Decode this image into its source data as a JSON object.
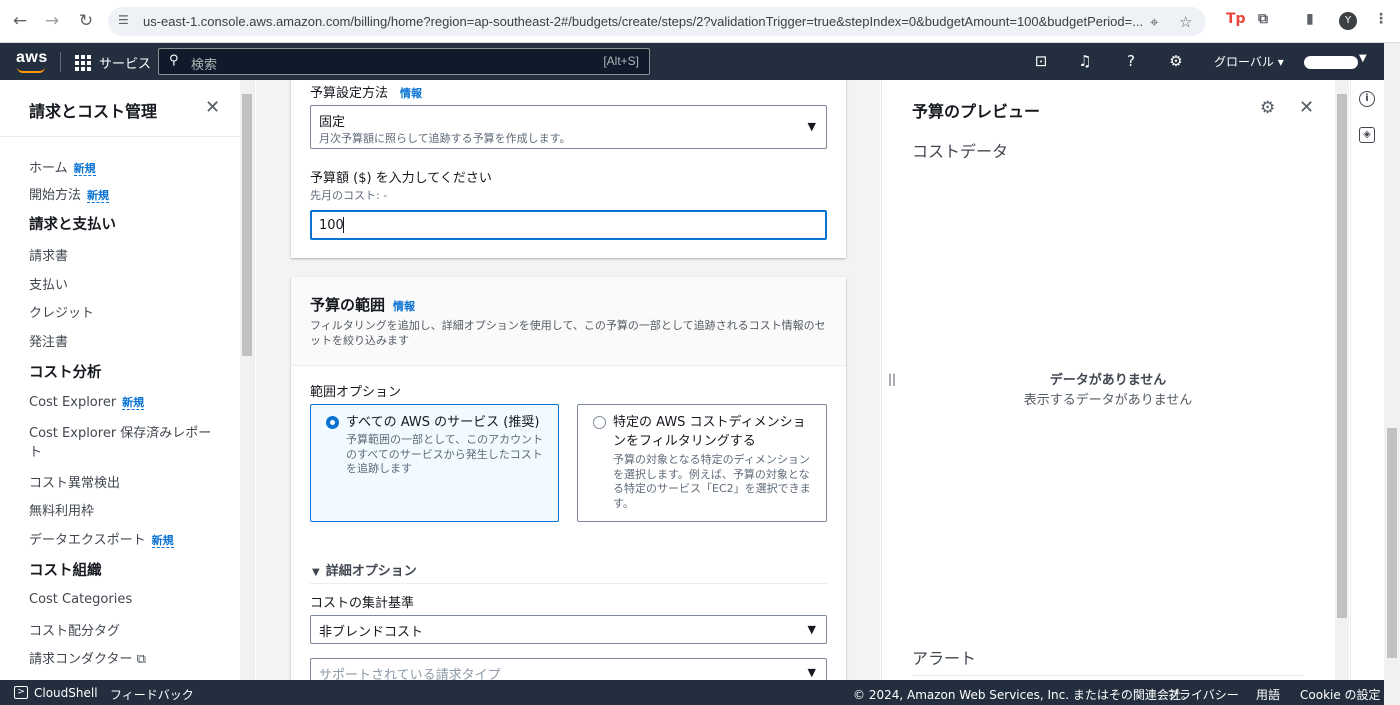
{
  "browser": {
    "url": "us-east-1.console.aws.amazon.com/billing/home?region=ap-southeast-2#/budgets/create/steps/2?validationTrigger=true&stepIndex=0&budgetAmount=100&budgetPeriod=...",
    "avatar_letter": "Y"
  },
  "topnav": {
    "logo": "aws",
    "services": "サービス",
    "search_placeholder": "検索",
    "search_shortcut": "[Alt+S]",
    "region": "グローバル ▾"
  },
  "sidebar": {
    "title": "請求とコスト管理",
    "new_label": "新規",
    "items": {
      "home": "ホーム",
      "getting_started": "開始方法",
      "billing_head": "請求と支払い",
      "bills": "請求書",
      "payments": "支払い",
      "credits": "クレジット",
      "purchase_orders": "発注書",
      "cost_analysis_head": "コスト分析",
      "cost_explorer": "Cost Explorer",
      "saved_reports": "Cost Explorer 保存済みレポー",
      "saved_reports_wrap": "ト",
      "anomaly": "コスト異常検出",
      "free_tier": "無料利用枠",
      "data_exports": "データエクスポート",
      "cost_org_head": "コスト組織",
      "cost_categories": "Cost Categories",
      "cost_tags": "コスト配分タグ",
      "billing_conductor": "請求コンダクター"
    }
  },
  "form": {
    "info": "情報",
    "method_label": "予算設定方法",
    "method_value": "固定",
    "method_desc": "月次予算額に照らして追跡する予算を作成します。",
    "amount_label": "予算額 ($) を入力してください",
    "amount_sub": "先月のコスト: -",
    "amount_value": "100",
    "scope_title": "予算の範囲",
    "scope_desc_1": "フィルタリングを追加し、詳細オプションを使用して、この予算の一部として追跡されるコスト情報のセ",
    "scope_desc_2": "ットを絞り込みます",
    "scope_options_label": "範囲オプション",
    "all_services_title": "すべての AWS のサービス (推奨)",
    "all_services_desc_1": "予算範囲の一部として、このアカウント",
    "all_services_desc_2": "のすべてのサービスから発生したコスト",
    "all_services_desc_3": "を追跡します",
    "filter_title_1": "特定の AWS コストディメンショ",
    "filter_title_2": "ンをフィルタリングする",
    "filter_desc_1": "予算の対象となる特定のディメンション",
    "filter_desc_2": "を選択します。例えば、予算の対象とな",
    "filter_desc_3": "る特定のサービス「EC2」を選択できま",
    "filter_desc_4": "す。",
    "advanced_toggle": "詳細オプション",
    "aggregate_label": "コストの集計基準",
    "aggregate_value": "非ブレンドコスト",
    "charge_types_placeholder": "サポートされている請求タイプ"
  },
  "preview": {
    "title": "予算のプレビュー",
    "cost_data": "コストデータ",
    "no_data_title": "データがありません",
    "no_data_desc": "表示するデータがありません",
    "alerts": "アラート"
  },
  "footer": {
    "cloudshell": "CloudShell",
    "feedback": "フィードバック",
    "copyright": "© 2024, Amazon Web Services, Inc. またはその関連会社。",
    "privacy": "プライバシー",
    "terms": "用語",
    "cookie": "Cookie の設定"
  }
}
